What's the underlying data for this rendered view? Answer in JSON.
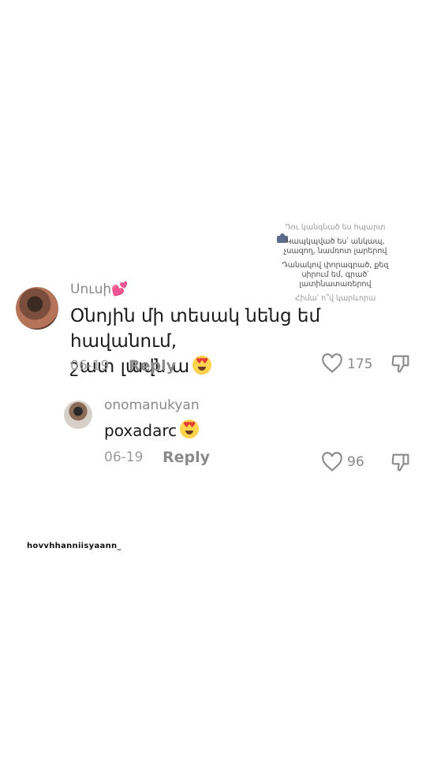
{
  "overlay": {
    "line1": "Դու կանգնած ես հպարտ",
    "line2": "Կապկպված ես՝ անկապ,",
    "line3": "չսազող, նամռոտ լարերով",
    "line4": "Դանակով փորագրած, քեզ",
    "line5": "սիրում եմ, գրած՝",
    "line6": "լատինատառերով",
    "line7": "Հիմա՝ ո՞վ կարևորա"
  },
  "comments": [
    {
      "username": "Սուսի💕",
      "text_line1": "Օնոյին մի տեսակ նենց եմ հավանում,",
      "text_line2": "շատ լավն ա",
      "date": "06-19",
      "reply_label": "Reply",
      "likes": "175"
    },
    {
      "username": "onomanukyan",
      "text": "poxadarc",
      "date": "06-19",
      "reply_label": "Reply",
      "likes": "96"
    }
  ],
  "watermark": "hovvhhanniisyaann_",
  "colors": {
    "text": "#1a1a1a",
    "muted": "#8a8a8a",
    "background": "#ffffff"
  },
  "icons": [
    "heart-outline-icon",
    "thumbs-down-icon",
    "heart-eyes-emoji"
  ]
}
